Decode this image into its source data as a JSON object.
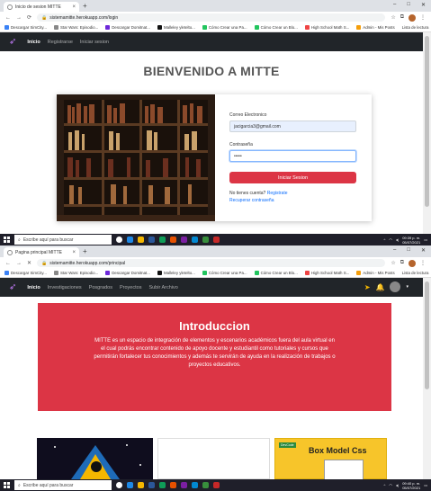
{
  "login_window": {
    "tab_title": "Inicio de sesion MITTE",
    "url": "sistemamitte.herokuapp.com/login",
    "bookmarks": [
      "Descargar SimCity...",
      "Star Wars: Episodio...",
      "Descargar Domitnat...",
      "Malleley yletelto...",
      "Cómo Crear una Pa...",
      "Cómo Crear un Blo...",
      "High School Math S...",
      "Admin - Mis Posts"
    ],
    "reading_list": "Lista de lectura",
    "nav": {
      "inicio": "Inicio",
      "registrarse": "Registrarse",
      "iniciar": "Iniciar sesion"
    },
    "welcome": "BIENVENIDO A MITTE",
    "form": {
      "email_label": "Correo Electronico",
      "email_value": "jacigarcia3@gmail.com",
      "password_label": "Contraseña",
      "password_value": "•••••",
      "login_button": "Iniciar Sesion",
      "no_account": "No tienes cuenta?",
      "register_link": "Registrate",
      "recover_link": "Recuperar contraseña"
    },
    "taskbar": {
      "search": "Escribe aquí para buscar",
      "lang": "ESP\nLAA",
      "time": "09:39 p. m.",
      "date": "05/07/2021"
    }
  },
  "main_window": {
    "tab_title": "Pagina principal MITTE",
    "url": "sistemamitte.herokuapp.com/principal",
    "nav": {
      "inicio": "Inicio",
      "inv": "Investigaciones",
      "posgrados": "Posgrados",
      "proyectos": "Proyectos",
      "subir": "Subir Archivo"
    },
    "intro_title": "Introduccion",
    "intro_text": "MITTE es un espacio de integración de elementos y escenarios académicos fuera del aula virtual en el cual podrás encontrar contenido de apoyo docente y estudiantil como tutoriales y cursos que permitirán fortalecer tus conocimientos y además te servirán de ayuda en la realización de trabajos o proyectos educativos.",
    "card3_title": "Box Model Css",
    "card3_tag": "DevCode",
    "taskbar": {
      "search": "Escribe aquí para buscar",
      "lang": "ESP\nLAA",
      "time": "09:40 p. m.",
      "date": "05/07/2021"
    }
  }
}
